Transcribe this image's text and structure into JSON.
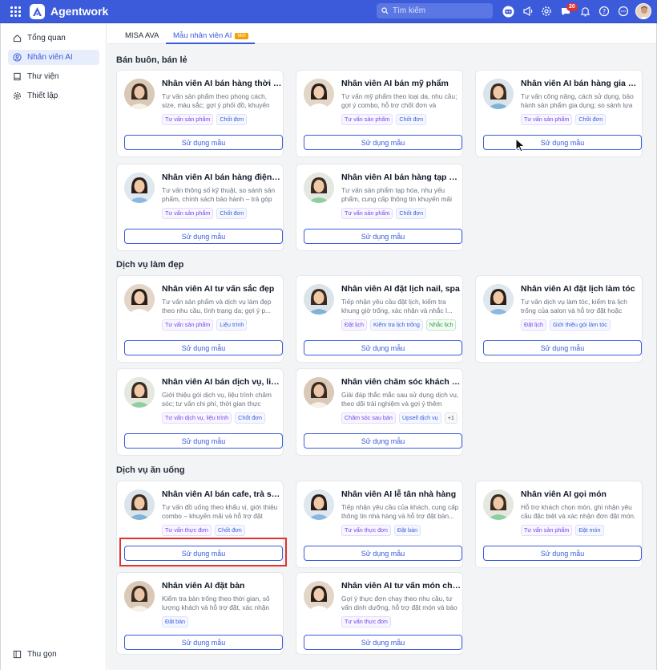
{
  "app": {
    "title": "Agentwork"
  },
  "header": {
    "search_placeholder": "Tìm kiếm",
    "notification_count": "20"
  },
  "sidebar": {
    "items": [
      {
        "label": "Tổng quan",
        "icon": "home-icon"
      },
      {
        "label": "Nhân viên AI",
        "icon": "user-circle-icon",
        "active": true
      },
      {
        "label": "Thư viện",
        "icon": "book-icon"
      },
      {
        "label": "Thiết lập",
        "icon": "gear-icon"
      }
    ],
    "collapse_label": "Thu gọn"
  },
  "tabs": [
    {
      "label": "MISA AVA"
    },
    {
      "label": "Mẫu nhân viên AI",
      "badge": "Mới",
      "active": true
    }
  ],
  "use_template_label": "Sử dụng mẫu",
  "sections": [
    {
      "title": "Bán buôn, bán lẻ",
      "cards": [
        {
          "title": "Nhân viên AI bán hàng thời trang",
          "desc": "Tư vấn sản phẩm theo phong cách, size, màu sắc; gợi ý phối đồ, khuyến mãi và...",
          "tags": [
            {
              "t": "Tư vấn sản phẩm",
              "c": "purple"
            },
            {
              "t": "Chốt đơn",
              "c": "blue"
            }
          ]
        },
        {
          "title": "Nhân viên AI bán mỹ phẩm",
          "desc": "Tư vấn mỹ phẩm theo loại da, nhu cầu; gợi ý combo, hỗ trợ chốt đơn và khuyế...",
          "tags": [
            {
              "t": "Tư vấn sản phẩm",
              "c": "purple"
            },
            {
              "t": "Chốt đơn",
              "c": "blue"
            }
          ]
        },
        {
          "title": "Nhân viên AI bán hàng gia dụng",
          "desc": "Tư vấn công năng, cách sử dụng, bảo hành sản phẩm gia dụng; so sánh lựa c...",
          "tags": [
            {
              "t": "Tư vấn sản phẩm",
              "c": "purple"
            },
            {
              "t": "Chốt đơn",
              "c": "blue"
            }
          ]
        },
        {
          "title": "Nhân viên AI bán hàng điện máy",
          "desc": "Tư vấn thông số kỹ thuật, so sánh sản phẩm, chính sách bảo hành – trả góp v...",
          "tags": [
            {
              "t": "Tư vấn sản phẩm",
              "c": "purple"
            },
            {
              "t": "Chốt đơn",
              "c": "blue"
            }
          ]
        },
        {
          "title": "Nhân viên AI bán hàng tạp hóa,...",
          "desc": "Tư vấn sản phẩm tạp hóa, nhu yếu phẩm, cung cấp thông tin khuyến mãi và xử lý...",
          "tags": [
            {
              "t": "Tư vấn sản phẩm",
              "c": "purple"
            },
            {
              "t": "Chốt đơn",
              "c": "blue"
            }
          ]
        }
      ]
    },
    {
      "title": "Dịch vụ làm đẹp",
      "cards": [
        {
          "title": "Nhân viên AI tư vấn sắc đẹp",
          "desc": "Tư vấn sản phẩm và dịch vụ làm đẹp theo nhu cầu, tình trạng da; gợi ý p...",
          "tags": [
            {
              "t": "Tư vấn sản phẩm",
              "c": "purple"
            },
            {
              "t": "Liệu trình",
              "c": "blue"
            }
          ]
        },
        {
          "title": "Nhân viên AI đặt lịch nail, spa",
          "desc": "Tiếp nhận yêu cầu đặt lịch, kiểm tra khung giờ trống, xác nhận và nhắc l...",
          "tags": [
            {
              "t": "Đặt lịch",
              "c": "purple"
            },
            {
              "t": "Kiểm tra lịch trống",
              "c": "blue"
            },
            {
              "t": "Nhắc lịch",
              "c": "green"
            }
          ]
        },
        {
          "title": "Nhân viên AI đặt lịch làm tóc",
          "desc": "Tư vấn dịch vụ làm tóc, kiểm tra lịch trống của salon và hỗ trợ đặt hoặc thay...",
          "tags": [
            {
              "t": "Đặt lịch",
              "c": "purple"
            },
            {
              "t": "Giới thiệu gói làm tóc",
              "c": "blue"
            }
          ]
        },
        {
          "title": "Nhân viên AI bán dịch vụ, liệu t...",
          "desc": "Giới thiệu gói dịch vụ, liệu trình chăm sóc; tư vấn chi phí, thời gian thực hiện...",
          "tags": [
            {
              "t": "Tư vấn dịch vụ, liệu trình",
              "c": "purple"
            },
            {
              "t": "Chốt đơn",
              "c": "blue"
            }
          ]
        },
        {
          "title": "Nhân viên chăm sóc khách hàn...",
          "desc": "Giải đáp thắc mắc sau sử dụng dịch vụ, theo dõi trải nghiệm và gợi ý thêm dịch...",
          "tags": [
            {
              "t": "Chăm sóc sau bán",
              "c": "purple"
            },
            {
              "t": "Upsell dịch vụ",
              "c": "blue"
            },
            {
              "t": "+1",
              "c": "gray"
            }
          ]
        }
      ]
    },
    {
      "title": "Dịch vụ ăn uống",
      "cards": [
        {
          "title": "Nhân viên AI bán cafe, trà sữa",
          "desc": "Tư vấn đồ uống theo khẩu vị, giới thiệu combo – khuyến mãi và hỗ trợ đặt mua...",
          "tags": [
            {
              "t": "Tư vấn thực đơn",
              "c": "purple"
            },
            {
              "t": "Chốt đơn",
              "c": "blue"
            }
          ]
        },
        {
          "title": "Nhân viên AI lễ tân nhà hàng",
          "desc": "Tiếp nhận yêu cầu của khách, cung cấp thông tin nhà hàng và hỗ trợ đặt bàn...",
          "tags": [
            {
              "t": "Tư vấn thực đơn",
              "c": "purple"
            },
            {
              "t": "Đặt bàn",
              "c": "blue"
            }
          ]
        },
        {
          "title": "Nhân viên AI gọi món",
          "desc": "Hỗ trợ khách chọn món, ghi nhận yêu cầu đặc biệt và xác nhận đơn đặt món.",
          "tags": [
            {
              "t": "Tư vấn sản phẩm",
              "c": "purple"
            },
            {
              "t": "Đặt món",
              "c": "blue"
            }
          ]
        },
        {
          "title": "Nhân viên AI đặt bàn",
          "desc": "Kiểm tra bàn trống theo thời gian, số lượng khách và hỗ trợ đặt, xác nhận lịc...",
          "tags": [
            {
              "t": "Đặt bàn",
              "c": "blue"
            }
          ]
        },
        {
          "title": "Nhân viên AI tư vấn món chay",
          "desc": "Gợi ý thực đơn chay theo nhu cầu, tư vấn dinh dưỡng, hỗ trợ đặt món và báo giá.",
          "tags": [
            {
              "t": "Tư vấn thực đơn",
              "c": "purple"
            }
          ]
        }
      ]
    }
  ],
  "colors": {
    "primary": "#3b5bdb",
    "header_bg": "#3b5bdb",
    "highlight": "#e03131",
    "badge": "#f59f00"
  }
}
